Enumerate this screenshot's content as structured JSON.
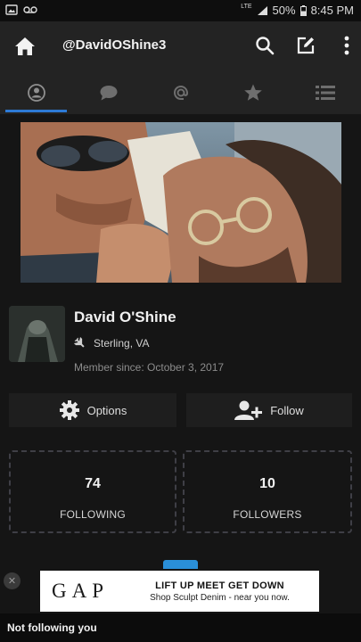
{
  "status_bar": {
    "network": "LTE",
    "battery": "50%",
    "time": "8:45 PM",
    "icons": [
      "image-icon",
      "voicemail-icon",
      "signal-icon",
      "battery-icon"
    ]
  },
  "app_bar": {
    "handle": "@DavidOShine3",
    "icons": [
      "home-icon",
      "search-icon",
      "compose-icon",
      "more-vert-icon"
    ]
  },
  "tabs": [
    {
      "icon": "profile-icon",
      "active": true
    },
    {
      "icon": "chat-icon",
      "active": false
    },
    {
      "icon": "mention-icon",
      "active": false
    },
    {
      "icon": "star-icon",
      "active": false
    },
    {
      "icon": "list-icon",
      "active": false
    }
  ],
  "profile": {
    "name": "David O'Shine",
    "location": "Sterling, VA",
    "member_since": "Member since: October 3, 2017"
  },
  "actions": {
    "options_label": "Options",
    "follow_label": "Follow"
  },
  "stats": {
    "following_count": "74",
    "following_label": "FOLLOWING",
    "followers_count": "10",
    "followers_label": "FOLLOWERS"
  },
  "ad": {
    "brand": "GAP",
    "headline": "LIFT UP MEET GET DOWN",
    "subline": "Shop Sculpt Denim - near you now."
  },
  "toast": {
    "text": "Not following you"
  },
  "colors": {
    "accent": "#2d7ad6",
    "background": "#151515",
    "bar": "#232323"
  }
}
